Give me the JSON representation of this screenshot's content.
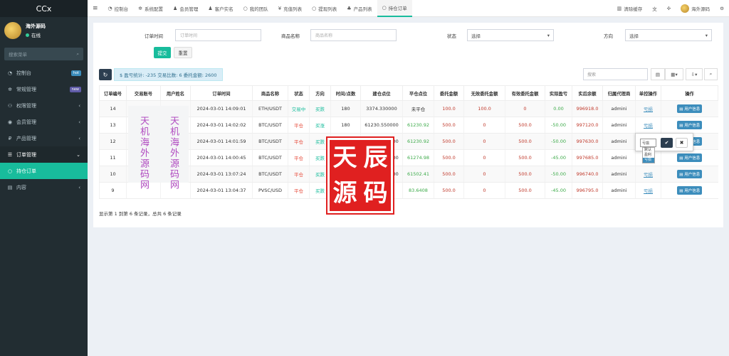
{
  "brand": "CCx",
  "user": {
    "name": "海外源码",
    "status": "在线"
  },
  "sidebar": {
    "search_placeholder": "搜索菜单",
    "items": [
      {
        "label": "控制台",
        "icon": "dashboard-icon",
        "badge": "hot",
        "badge_color": "#3c8dbc"
      },
      {
        "label": "常规管理",
        "icon": "cogs-icon",
        "badge": "new",
        "badge_color": "#605ca8"
      },
      {
        "label": "权限管理",
        "icon": "users-icon",
        "arrow": "‹"
      },
      {
        "label": "会员管理",
        "icon": "user-circle-icon",
        "arrow": "‹"
      },
      {
        "label": "产品管理",
        "icon": "product-icon",
        "arrow": "‹"
      },
      {
        "label": "订单管理",
        "icon": "list-icon",
        "arrow": "⌄"
      },
      {
        "label": "持仓订单",
        "icon": "circle-icon"
      },
      {
        "label": "内容",
        "icon": "content-icon",
        "arrow": "‹"
      }
    ]
  },
  "topnav": {
    "tabs": [
      {
        "label": "控制台",
        "icon": "dashboard-icon"
      },
      {
        "label": "系统配置",
        "icon": "gear-icon"
      },
      {
        "label": "会员管理",
        "icon": "user-icon"
      },
      {
        "label": "客户实名",
        "icon": "id-icon"
      },
      {
        "label": "我的团队",
        "icon": "circle-icon"
      },
      {
        "label": "充值列表",
        "icon": "yen-icon"
      },
      {
        "label": "提现列表",
        "icon": "circle-icon"
      },
      {
        "label": "产品列表",
        "icon": "product-icon"
      },
      {
        "label": "持仓订单",
        "icon": "circle-icon"
      }
    ],
    "clear_cache": "清除缓存",
    "username": "海外源码"
  },
  "filters": {
    "order_time_label": "订单时间",
    "order_time_placeholder": "订单时间",
    "product_label": "商品名称",
    "product_placeholder": "商品名称",
    "status_label": "状态",
    "status_value": "选择",
    "direction_label": "方向",
    "direction_value": "选择",
    "submit": "提交",
    "reset": "重置"
  },
  "toolbar": {
    "stats": "$ 盈亏统计: -235 交易比数: 6 委托金额: 2600",
    "search_placeholder": "搜索"
  },
  "table": {
    "headers": [
      "订单编号",
      "交易账号",
      "用户姓名",
      "订单时间",
      "商品名称",
      "状态",
      "方向",
      "时间/点数",
      "建仓点位",
      "平仓点位",
      "委托金额",
      "无效委托金额",
      "有效委托金额",
      "实际盈亏",
      "实后余额",
      "归属代理商",
      "单控操作",
      "操作"
    ],
    "rows": [
      {
        "id": "14",
        "time": "2024-03-01 14:09:01",
        "product": "ETH/USDT",
        "status": "交易中",
        "dir": "买跌",
        "pts": "180",
        "open": "3374.330000",
        "close": "未平仓",
        "amount": "100.0",
        "invalid": "100.0",
        "valid": "0",
        "pnl": "0.00",
        "balance": "996918.0",
        "agent": "admini",
        "ctrl": "亏损",
        "op": "用户信息"
      },
      {
        "id": "13",
        "time": "2024-03-01 14:02:02",
        "product": "BTC/USDT",
        "status": "平仓",
        "dir": "买涨",
        "pts": "180",
        "open": "61230.550000",
        "close": "61230.92",
        "amount": "500.0",
        "invalid": "0",
        "valid": "500.0",
        "pnl": "-50.00",
        "balance": "997120.0",
        "agent": "admini",
        "ctrl": "亏损",
        "op": "用户信息"
      },
      {
        "id": "12",
        "time": "2024-03-01 14:01:59",
        "product": "BTC/USDT",
        "status": "平仓",
        "dir": "买跌",
        "pts": "180",
        "open": "61230.550000",
        "close": "61230.92",
        "amount": "500.0",
        "invalid": "0",
        "valid": "500.0",
        "pnl": "-50.00",
        "balance": "997630.0",
        "agent": "admini",
        "ctrl": "亏损",
        "op": "用户信息"
      },
      {
        "id": "11",
        "time": "2024-03-01 14:00:45",
        "product": "BTC/USDT",
        "status": "平仓",
        "dir": "买跌",
        "pts": "180",
        "open": "61274.550000",
        "close": "61274.98",
        "amount": "500.0",
        "invalid": "0",
        "valid": "500.0",
        "pnl": "-45.00",
        "balance": "997685.0",
        "agent": "admini",
        "ctrl": "亏损",
        "op": "用户信息"
      },
      {
        "id": "10",
        "time": "2024-03-01 13:07:24",
        "product": "BTC/USDT",
        "status": "平仓",
        "dir": "买跌",
        "pts": "180",
        "open": "61502.050000",
        "close": "61502.41",
        "amount": "500.0",
        "invalid": "0",
        "valid": "500.0",
        "pnl": "-50.00",
        "balance": "996740.0",
        "agent": "admini",
        "ctrl": "亏损",
        "op": "用户信息"
      },
      {
        "id": "9",
        "time": "2024-03-01 13:04:37",
        "product": "PVSC/USD",
        "status": "平仓",
        "dir": "买跌",
        "pts": "180",
        "open": "83.640000",
        "close": "83.6408",
        "amount": "500.0",
        "invalid": "0",
        "valid": "500.0",
        "pnl": "-45.00",
        "balance": "996795.0",
        "agent": "admini",
        "ctrl": "亏损",
        "op": "用户信息"
      }
    ],
    "footer": "显示第 1 到第 6 条记录，总共 6 条记录"
  },
  "popover": {
    "value": "亏损",
    "options": [
      "默认",
      "盈利",
      "亏损"
    ]
  },
  "watermark": {
    "chars": [
      "天",
      "辰",
      "源",
      "码"
    ],
    "vertical_1": "天机海外源码网",
    "vertical_2": "天机海外源码网"
  }
}
